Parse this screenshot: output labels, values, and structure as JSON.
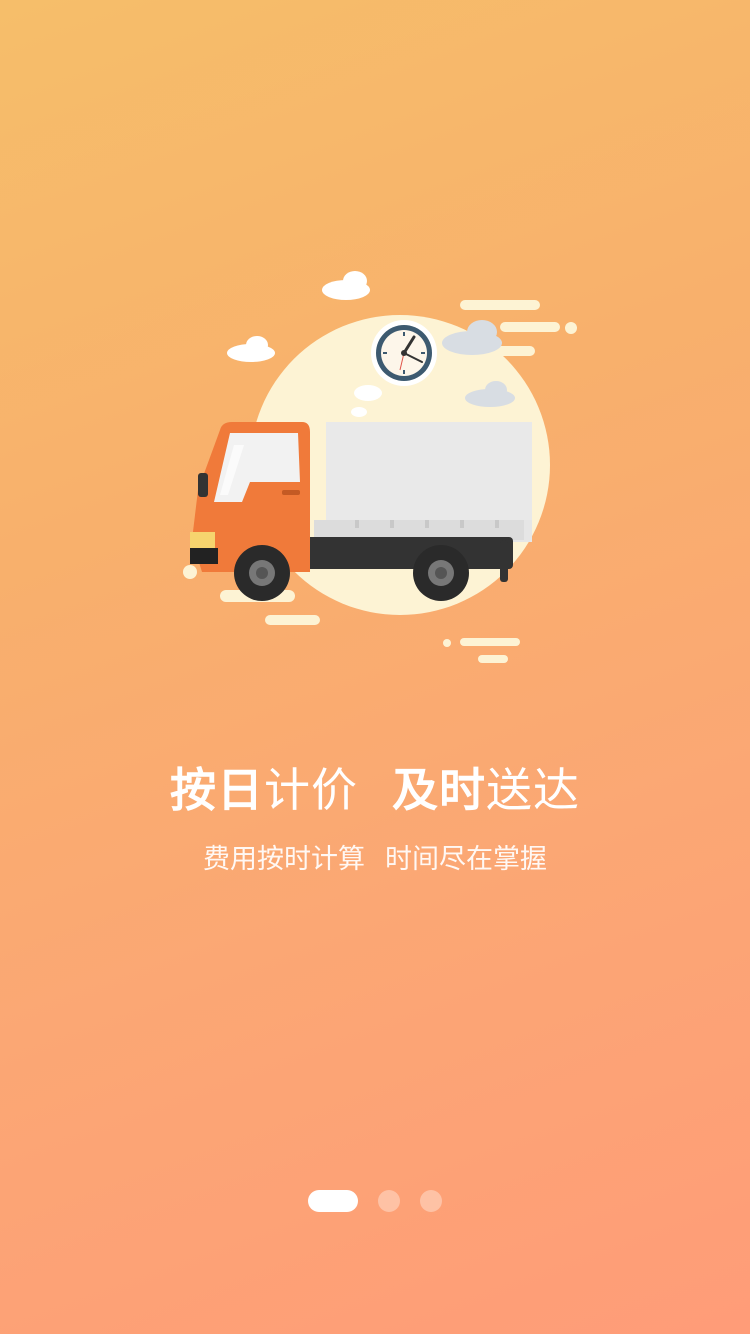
{
  "slide": {
    "headline": {
      "part1_bold": "按日",
      "part1_light": "计价",
      "part2_bold": "及时",
      "part2_light": "送达"
    },
    "subtitle": {
      "part1": "费用按时计算",
      "part2": "时间尽在掌握"
    }
  },
  "pager": {
    "total": 3,
    "active_index": 0
  },
  "illustration": {
    "subject": "delivery-truck-with-clock",
    "colors": {
      "cab": "#f07a3a",
      "cargo_box": "#e6e6e6",
      "chassis": "#333333",
      "sun_circle": "#fdf3d4",
      "clock_rim": "#3d5a70"
    }
  }
}
